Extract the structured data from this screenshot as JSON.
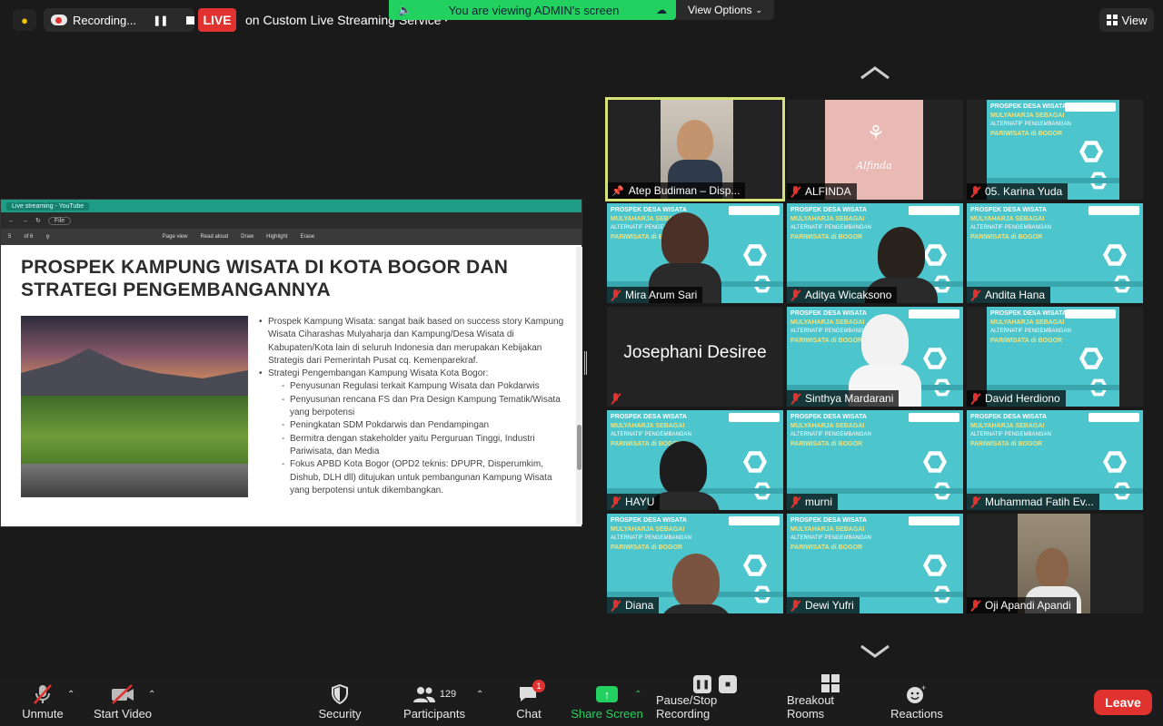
{
  "top": {
    "recording_label": "Recording...",
    "live_badge": "LIVE",
    "live_service": "on Custom Live Streaming Service",
    "banner_text": "You are viewing ADMIN's screen",
    "view_options": "View Options",
    "view_button": "View"
  },
  "shared": {
    "window_tab": "Live streaming - YouTube",
    "file_button": "File",
    "page_indicator": "5",
    "page_total": "of 6",
    "tool_page_view": "Page view",
    "tool_read_aloud": "Read aloud",
    "tool_draw": "Draw",
    "tool_highlight": "Highlight",
    "tool_erase": "Erase",
    "slide_title": "PROSPEK KAMPUNG WISATA DI KOTA BOGOR DAN STRATEGI PENGEMBANGANNYA",
    "bullets": [
      {
        "type": "b",
        "text": "Prospek Kampung Wisata: sangat baik based on success story Kampung Wisata Ciharashas Mulyaharja dan Kampung/Desa Wisata di Kabupaten/Kota lain di seluruh Indonesia dan merupakan Kebijakan Strategis dari Pemerintah Pusat cq. Kemenparekraf."
      },
      {
        "type": "b",
        "text": "Strategi Pengembangan Kampung Wisata Kota Bogor:"
      },
      {
        "type": "s",
        "text": "Penyusunan Regulasi terkait Kampung Wisata dan Pokdarwis"
      },
      {
        "type": "s",
        "text": "Penyusunan rencana FS dan Pra Design Kampung Tematik/Wisata yang berpotensi"
      },
      {
        "type": "s",
        "text": "Peningkatan SDM Pokdarwis dan Pendampingan"
      },
      {
        "type": "s",
        "text": "Bermitra dengan stakeholder yaitu Perguruan Tinggi, Industri Pariwisata, dan Media"
      },
      {
        "type": "s",
        "text": "Fokus APBD Kota Bogor (OPD2 teknis: DPUPR, Disperumkim, Dishub, DLH dll) ditujukan untuk pembangunan Kampung Wisata yang berpotensi untuk dikembangkan."
      }
    ]
  },
  "slide_art": {
    "line1": "PROSPEK DESA WISATA",
    "line2": "MULYAHARJA SEBAGAI",
    "line3": "ALTERNATIF PENGEMBANGAN",
    "line4": "PARIWISATA di BOGOR"
  },
  "participants": [
    {
      "name": "Atep Budiman – Disp...",
      "pinned": true
    },
    {
      "name": "ALFINDA",
      "muted": true,
      "art_text": "Alfinda"
    },
    {
      "name": "05. Karina Yuda",
      "muted": true
    },
    {
      "name": "Mira Arum Sari",
      "muted": true
    },
    {
      "name": "Aditya Wicaksono",
      "muted": true
    },
    {
      "name": "Andita Hana",
      "muted": true
    },
    {
      "name": "Josephani Desiree",
      "muted": true
    },
    {
      "name": "Sinthya Mardarani",
      "muted": true
    },
    {
      "name": "David Herdiono",
      "muted": true
    },
    {
      "name": "HAYU",
      "muted": true
    },
    {
      "name": "murni",
      "muted": true
    },
    {
      "name": "Muhammad Fatih Ev...",
      "muted": true
    },
    {
      "name": "Diana",
      "muted": true
    },
    {
      "name": "Dewi Yufri",
      "muted": true
    },
    {
      "name": "Oji Apandi Apandi",
      "muted": true
    }
  ],
  "bottom": {
    "unmute": "Unmute",
    "start_video": "Start Video",
    "security": "Security",
    "participants_label": "Participants",
    "participants_count": "129",
    "chat": "Chat",
    "chat_badge": "1",
    "share_screen": "Share Screen",
    "pause_stop": "Pause/Stop Recording",
    "breakout": "Breakout Rooms",
    "reactions": "Reactions",
    "leave": "Leave"
  },
  "colors": {
    "live": "#e0332f",
    "banner": "#23d160",
    "active_speaker": "#d8e27a",
    "slide_teal": "#4cc6cc"
  }
}
